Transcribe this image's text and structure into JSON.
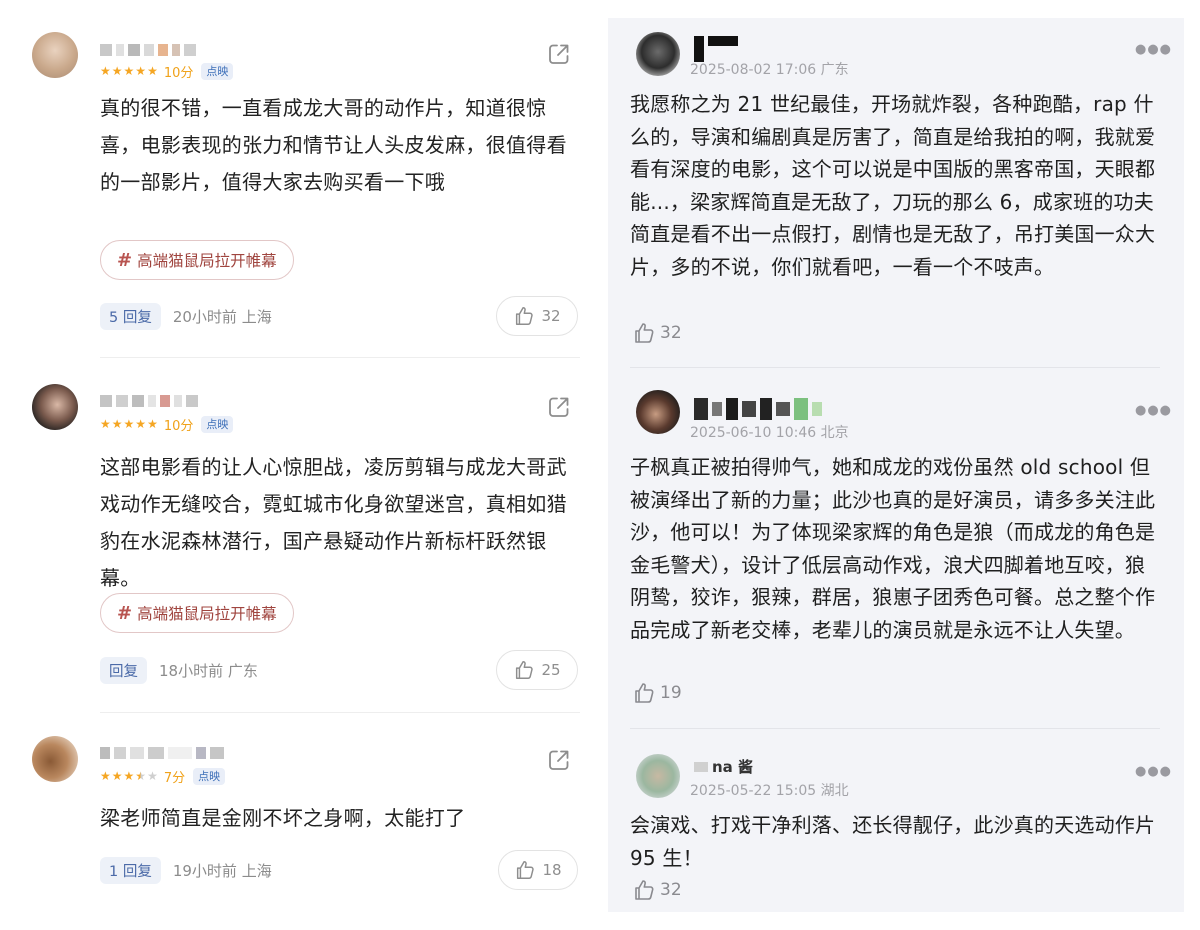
{
  "left_comments": [
    {
      "score": "10分",
      "stars_filled": 5,
      "tag": "点映",
      "text": "真的很不错，一直看成龙大哥的动作片，知道很惊喜，电影表现的张力和情节让人头皮发麻，很值得看的一部影片，值得大家去购买看一下哦",
      "topic": "高端猫鼠局拉开帷幕",
      "replies": "5 回复",
      "meta": "20小时前 上海",
      "likes": "32"
    },
    {
      "score": "10分",
      "stars_filled": 5,
      "tag": "点映",
      "text": "这部电影看的让人心惊胆战，凌厉剪辑与成龙大哥武戏动作无缝咬合，霓虹城市化身欲望迷宫，真相如猎豹在水泥森林潜行，国产悬疑动作片新标杆跃然银幕。",
      "topic": "高端猫鼠局拉开帷幕",
      "replies": "回复",
      "meta": "18小时前 广东",
      "likes": "25"
    },
    {
      "score": "7分",
      "stars_filled": 3.5,
      "tag": "点映",
      "text": "梁老师简直是金刚不坏之身啊，太能打了",
      "replies": "1 回复",
      "meta": "19小时前 上海",
      "likes": "18"
    }
  ],
  "right_comments": [
    {
      "date": "2025-08-02 17:06 广东",
      "text": "我愿称之为 21 世纪最佳，开场就炸裂，各种跑酷，rap 什么的，导演和编剧真是厉害了，简直是给我拍的啊，我就爱看有深度的电影，这个可以说是中国版的黑客帝国，天眼都能...，梁家辉简直是无敌了，刀玩的那么 6，成家班的功夫简直是看不出一点假打，剧情也是无敌了，吊打美国一众大片，多的不说，你们就看吧，一看一个不吱声。",
      "likes": "32"
    },
    {
      "date": "2025-06-10 10:46 北京",
      "text": "子枫真正被拍得帅气，她和成龙的戏份虽然 old school 但被演绎出了新的力量；此沙也真的是好演员，请多多关注此沙，他可以！为了体现梁家辉的角色是狼（而成龙的角色是金毛警犬），设计了低层高动作戏，浪犬四脚着地互咬，狼阴鸷，狡诈，狠辣，群居，狼崽子团秀色可餐。总之整个作品完成了新老交棒，老辈儿的演员就是永远不让人失望。",
      "likes": "19"
    },
    {
      "name_visible": "na 酱",
      "date": "2025-05-22 15:05 湖北",
      "text": "会演戏、打戏干净利落、还长得靓仔，此沙真的天选动作片 95 生！",
      "likes": "32"
    }
  ],
  "icons": {
    "share": "share-icon",
    "like": "thumbs-up-icon",
    "more": "more-dots-icon",
    "star": "star-icon"
  },
  "colors": {
    "star": "#f5a623",
    "score": "#f0a21a",
    "tag_text": "#3d6fb8",
    "topic_text": "#a0453f",
    "right_bg": "#f3f4f8"
  }
}
